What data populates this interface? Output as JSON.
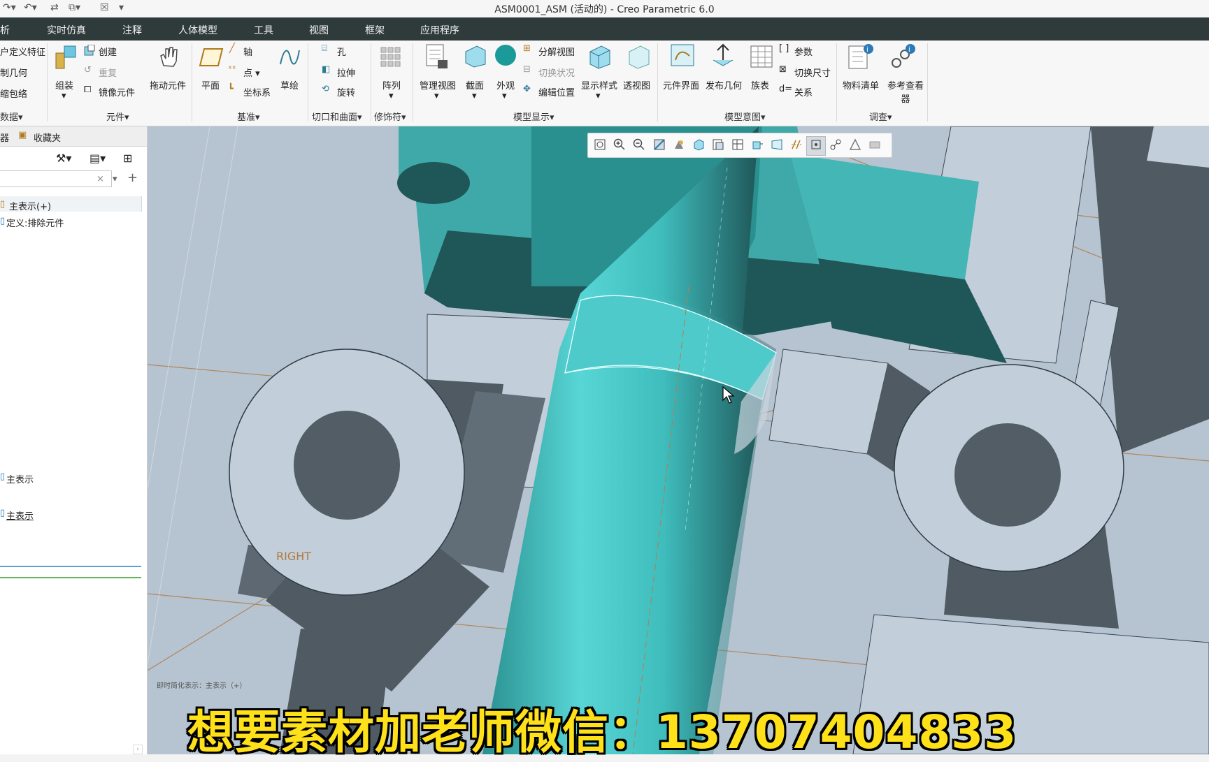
{
  "window": {
    "title": "ASM0001_ASM (活动的) - Creo Parametric 6.0"
  },
  "menu": {
    "items": [
      "析",
      "实时仿真",
      "注释",
      "人体模型",
      "工具",
      "视图",
      "框架",
      "应用程序"
    ]
  },
  "ribbon": {
    "left_items": [
      "户定义特征",
      "制几何",
      "缩包络"
    ],
    "left_group": "数据",
    "component": {
      "assemble": "组装",
      "create": "创建",
      "repeat": "重复",
      "mirror": "镜像元件",
      "drag": "拖动元件",
      "group": "元件"
    },
    "datum": {
      "plane": "平面",
      "axis": "轴",
      "point": "点",
      "csys": "坐标系",
      "sketch": "草绘",
      "group": "基准"
    },
    "cut": {
      "hole": "孔",
      "extrude": "拉伸",
      "revolve": "旋转",
      "group": "切口和曲面"
    },
    "modifier": {
      "pattern": "阵列",
      "group": "修饰符"
    },
    "display": {
      "manage_views": "管理视图",
      "section": "截面",
      "appearance": "外观",
      "explode": "分解视图",
      "toggle_status": "切换状况",
      "edit_position": "编辑位置",
      "display_style": "显示样式",
      "perspective": "透视图",
      "group": "模型显示"
    },
    "intent": {
      "component_interface": "元件界面",
      "publish_geometry": "发布几何",
      "family_table": "族表",
      "params": "参数",
      "switch_dims": "切换尺寸",
      "relations": "关系",
      "group": "模型意图"
    },
    "investigate": {
      "bom": "物料清单",
      "ref_viewer": "参考查看器",
      "group": "调查"
    }
  },
  "sidebar": {
    "tab_tree": "器",
    "tab_favorites": "收藏夹",
    "search_value": "",
    "items": [
      "主表示(+)",
      "定义:排除元件",
      "主表示",
      "主表示"
    ]
  },
  "viewport": {
    "datum_label": "RIGHT",
    "status_text": "即时简化表示：主表示（+）"
  },
  "caption": "想要素材加老师微信：13707404833",
  "colors": {
    "menubar": "#2f3b3b",
    "model_teal": "#3fbcbc",
    "viewport_bg": "#b6c4d1",
    "caption": "#ffe11a"
  }
}
